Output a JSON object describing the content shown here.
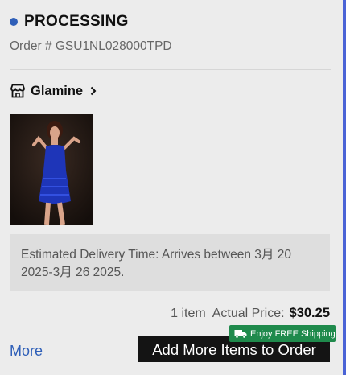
{
  "order": {
    "status": "PROCESSING",
    "number_text": "Order # GSU1NL028000TPD"
  },
  "store": {
    "name": "Glamine",
    "icon": "store-icon",
    "chevron_icon": "chevron-right-icon"
  },
  "product": {
    "image_icon": "product-photo"
  },
  "delivery": {
    "line1": "Estimated Delivery Time: Arrives between 3月 20",
    "line2": "2025-3月 26 2025."
  },
  "summary": {
    "item_count": "1 item",
    "actual_label": "Actual Price:",
    "price": "$30.25"
  },
  "actions": {
    "more_label": "More",
    "add_label": "Add More Items to Order",
    "free_shipping_label": "Enjoy FREE Shipping"
  },
  "colors": {
    "status_dot": "#2f5fb8",
    "link": "#2f5fb8",
    "button_bg": "#141414",
    "badge_bg": "#1f8a4c",
    "edge": "#4a63d6"
  }
}
